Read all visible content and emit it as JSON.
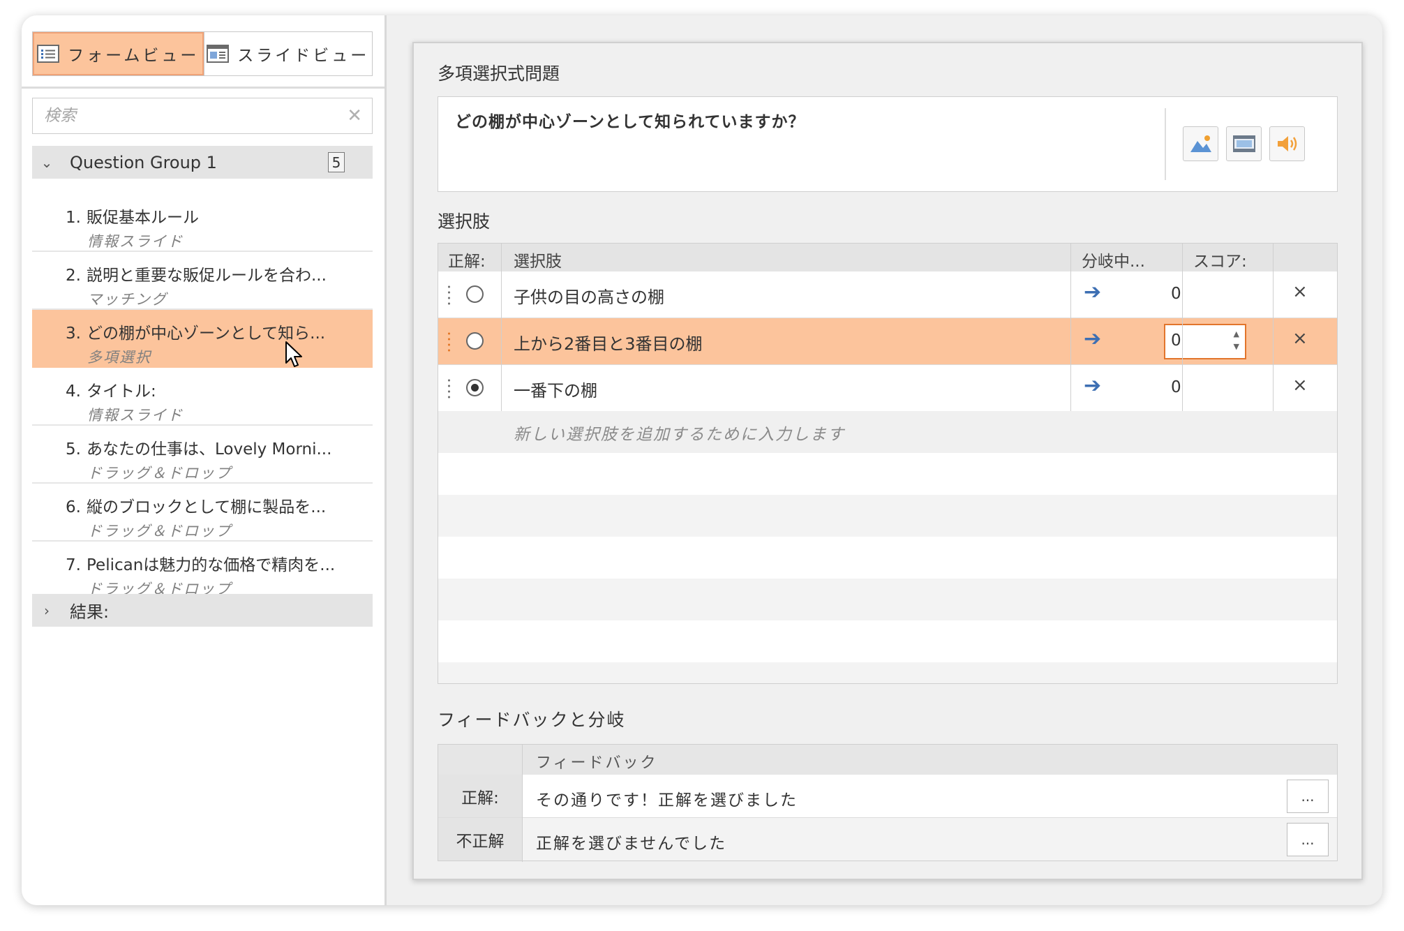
{
  "sidebar": {
    "views": [
      {
        "label": "フォームビュー",
        "active": true
      },
      {
        "label": "スライドビュー",
        "active": false
      }
    ],
    "search": {
      "placeholder": "検索",
      "value": ""
    },
    "group": {
      "title": "Question Group 1",
      "count": "5"
    },
    "questions": [
      {
        "number": "1.",
        "title": "販促基本ルール",
        "type": "情報スライド"
      },
      {
        "number": "2.",
        "title": "説明と重要な販促ルールを合わ...",
        "type": "マッチング"
      },
      {
        "number": "3.",
        "title": "どの棚が中心ゾーンとして知ら...",
        "type": "多項選択"
      },
      {
        "number": "4.",
        "title": "タイトル:",
        "type": "情報スライド"
      },
      {
        "number": "5.",
        "title": "あなたの仕事は、Lovely Morni...",
        "type": "ドラッグ＆ドロップ"
      },
      {
        "number": "6.",
        "title": "縦のブロックとして棚に製品を...",
        "type": "ドラッグ＆ドロップ"
      },
      {
        "number": "7.",
        "title": "Pelicanは魅力的な価格で精肉を...",
        "type": "ドラッグ＆ドロップ"
      }
    ],
    "results": {
      "title": "結果:"
    }
  },
  "editor": {
    "question_section": "多項選択式問題",
    "question_text": "どの棚が中心ゾーンとして知られていますか？",
    "media_icons": [
      "image-icon",
      "video-icon",
      "audio-icon"
    ],
    "choices_section": "選択肢",
    "choices_header": {
      "correct": "正解:",
      "choice": "選択肢",
      "branch": "分岐中...",
      "score": "スコア:"
    },
    "choices": [
      {
        "text": "子供の目の高さの棚",
        "score": "0",
        "correct": false
      },
      {
        "text": "上から2番目と3番目の棚",
        "score": "0",
        "correct": false
      },
      {
        "text": "一番下の棚",
        "score": "0",
        "correct": true
      }
    ],
    "add_choice_placeholder": "新しい選択肢を追加するために入力します",
    "feedback_section": "フィードバックと分岐",
    "feedback_header": "フィードバック",
    "feedback": [
      {
        "label": "正解:",
        "text": "その通りです！正解を選びました"
      },
      {
        "label": "不正解",
        "text": "正解を選びませんでした"
      }
    ],
    "more_label": "...",
    "delete_label": "×",
    "branch_arrow": "➔"
  },
  "colors": {
    "selection": "#fcc49c",
    "accent": "#e2752c",
    "arrow": "#3d6fb3"
  }
}
